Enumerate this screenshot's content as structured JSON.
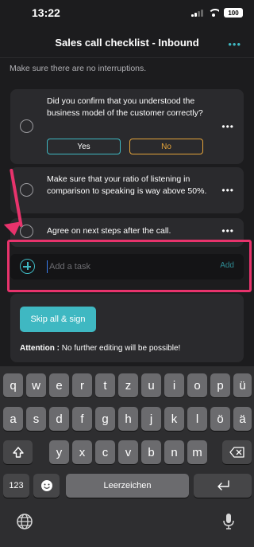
{
  "status": {
    "time": "13:22",
    "battery": "100"
  },
  "header": {
    "title": "Sales call checklist - Inbound",
    "more": "•••"
  },
  "hint": "Make sure there are no interruptions.",
  "tasks": [
    {
      "text": "Did you confirm that you understood the business model of the customer correctly?",
      "yes": "Yes",
      "no": "No",
      "more": "•••"
    },
    {
      "text": "Make sure that your ratio of listening in comparison to speaking is way above 50%.",
      "more": "•••"
    },
    {
      "text": "Agree on next steps after the call.",
      "more": "•••"
    }
  ],
  "add_task": {
    "placeholder": "Add a task",
    "button": "Add"
  },
  "sign": {
    "button": "Skip all & sign",
    "attention_label": "Attention :",
    "attention_text": "No further editing will be possible!"
  },
  "keyboard": {
    "row1": [
      "q",
      "w",
      "e",
      "r",
      "t",
      "z",
      "u",
      "i",
      "o",
      "p",
      "ü"
    ],
    "row2": [
      "a",
      "s",
      "d",
      "f",
      "g",
      "h",
      "j",
      "k",
      "l",
      "ö",
      "ä"
    ],
    "row3": [
      "y",
      "x",
      "c",
      "v",
      "b",
      "n",
      "m"
    ],
    "numbers_key": "123",
    "space_key": "Leerzeichen",
    "emoji_icon": "emoji-icon",
    "shift_icon": "shift-icon",
    "backspace_icon": "backspace-icon",
    "return_icon": "return-icon",
    "globe_icon": "globe-icon",
    "mic_icon": "microphone-icon"
  },
  "colors": {
    "accent": "#3fb8c2",
    "no": "#e5a43a",
    "highlight": "#e8336c",
    "background": "#1c1c1e",
    "card": "#2a2a2d"
  }
}
